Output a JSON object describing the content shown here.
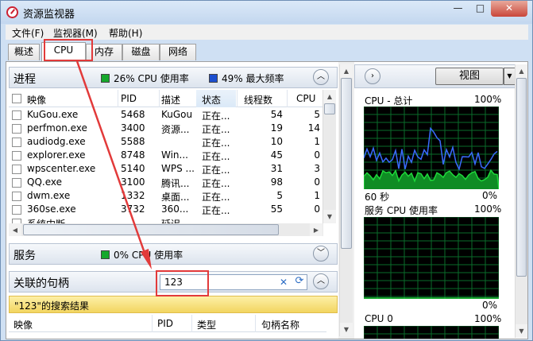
{
  "window": {
    "title": "资源监视器",
    "btn_min": "—",
    "btn_max": "□",
    "btn_close": "✕"
  },
  "menu": [
    "文件(F)",
    "监视器(M)",
    "帮助(H)"
  ],
  "tabs": [
    "概述",
    "CPU",
    "内存",
    "磁盘",
    "网络"
  ],
  "active_tab": "CPU",
  "processes": {
    "title": "进程",
    "cpu_usage": "26% CPU 使用率",
    "max_freq": "49% 最大频率",
    "meter_colors": {
      "usage": "#16a82c",
      "freq": "#1c4fcf"
    },
    "columns": [
      "映像",
      "PID",
      "描述",
      "状态",
      "线程数",
      "CPU"
    ],
    "rows": [
      [
        "KuGou.exe",
        "5468",
        "KuGou",
        "正在...",
        "54",
        "5"
      ],
      [
        "perfmon.exe",
        "3400",
        "资源...",
        "正在...",
        "19",
        "14"
      ],
      [
        "audiodg.exe",
        "5588",
        "",
        "正在...",
        "10",
        "1"
      ],
      [
        "explorer.exe",
        "8748",
        "Win...",
        "正在...",
        "45",
        "0"
      ],
      [
        "wpscenter.exe",
        "5140",
        "WPS ...",
        "正在...",
        "31",
        "3"
      ],
      [
        "QQ.exe",
        "3100",
        "腾讯...",
        "正在...",
        "98",
        "0"
      ],
      [
        "dwm.exe",
        "1332",
        "桌面...",
        "正在...",
        "5",
        "1"
      ],
      [
        "360se.exe",
        "3732",
        "360...",
        "正在...",
        "55",
        "0"
      ],
      [
        "系统中断",
        "",
        "延迟...",
        "",
        "",
        ""
      ]
    ]
  },
  "services": {
    "title": "服务",
    "cpu_usage": "0% CPU 使用率"
  },
  "handles": {
    "title": "关联的句柄",
    "search_value": "123",
    "clear": "✕",
    "refresh": "⟳",
    "results": "\"123\"的搜索结果",
    "columns": [
      "映像",
      "PID",
      "类型",
      "句柄名称"
    ]
  },
  "right": {
    "view_label": "视图",
    "graphs": [
      {
        "title": "CPU - 总计",
        "max": "100%",
        "min": "0%",
        "footer": "60 秒"
      },
      {
        "title": "服务 CPU 使用率",
        "max": "100%",
        "min": "0%"
      },
      {
        "title": "CPU 0",
        "max": "100%"
      }
    ]
  },
  "icons": {
    "collapse": "chevron-up-icon",
    "expand": "chevron-down-icon",
    "nav": "chevron-right-icon",
    "dropdown": "triangle-down-icon"
  }
}
